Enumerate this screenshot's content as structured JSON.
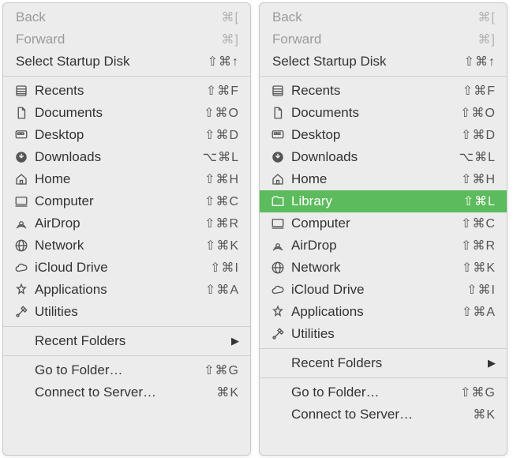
{
  "menus": [
    {
      "groups": [
        [
          {
            "id": "back",
            "label": "Back",
            "shortcut": "⌘[",
            "disabled": true,
            "noicon": true,
            "top": true
          },
          {
            "id": "forward",
            "label": "Forward",
            "shortcut": "⌘]",
            "disabled": true,
            "noicon": true,
            "top": true
          },
          {
            "id": "select-startup-disk",
            "label": "Select Startup Disk",
            "shortcut": "⇧⌘↑",
            "noicon": true,
            "top": true
          }
        ],
        [
          {
            "id": "recents",
            "label": "Recents",
            "shortcut": "⇧⌘F",
            "icon": "recents"
          },
          {
            "id": "documents",
            "label": "Documents",
            "shortcut": "⇧⌘O",
            "icon": "documents"
          },
          {
            "id": "desktop",
            "label": "Desktop",
            "shortcut": "⇧⌘D",
            "icon": "desktop"
          },
          {
            "id": "downloads",
            "label": "Downloads",
            "shortcut": "⌥⌘L",
            "icon": "downloads"
          },
          {
            "id": "home",
            "label": "Home",
            "shortcut": "⇧⌘H",
            "icon": "home"
          },
          {
            "id": "computer",
            "label": "Computer",
            "shortcut": "⇧⌘C",
            "icon": "computer"
          },
          {
            "id": "airdrop",
            "label": "AirDrop",
            "shortcut": "⇧⌘R",
            "icon": "airdrop"
          },
          {
            "id": "network",
            "label": "Network",
            "shortcut": "⇧⌘K",
            "icon": "network"
          },
          {
            "id": "icloud-drive",
            "label": "iCloud Drive",
            "shortcut": "⇧⌘I",
            "icon": "icloud"
          },
          {
            "id": "applications",
            "label": "Applications",
            "shortcut": "⇧⌘A",
            "icon": "applications"
          },
          {
            "id": "utilities",
            "label": "Utilities",
            "shortcut": "",
            "icon": "utilities"
          }
        ],
        [
          {
            "id": "recent-folders",
            "label": "Recent Folders",
            "submenu": true,
            "noicon": true
          }
        ],
        [
          {
            "id": "go-to-folder",
            "label": "Go to Folder…",
            "shortcut": "⇧⌘G",
            "noicon": true
          },
          {
            "id": "connect-to-server",
            "label": "Connect to Server…",
            "shortcut": "⌘K",
            "noicon": true
          }
        ]
      ]
    },
    {
      "groups": [
        [
          {
            "id": "back",
            "label": "Back",
            "shortcut": "⌘[",
            "disabled": true,
            "noicon": true,
            "top": true
          },
          {
            "id": "forward",
            "label": "Forward",
            "shortcut": "⌘]",
            "disabled": true,
            "noicon": true,
            "top": true
          },
          {
            "id": "select-startup-disk",
            "label": "Select Startup Disk",
            "shortcut": "⇧⌘↑",
            "noicon": true,
            "top": true
          }
        ],
        [
          {
            "id": "recents",
            "label": "Recents",
            "shortcut": "⇧⌘F",
            "icon": "recents"
          },
          {
            "id": "documents",
            "label": "Documents",
            "shortcut": "⇧⌘O",
            "icon": "documents"
          },
          {
            "id": "desktop",
            "label": "Desktop",
            "shortcut": "⇧⌘D",
            "icon": "desktop"
          },
          {
            "id": "downloads",
            "label": "Downloads",
            "shortcut": "⌥⌘L",
            "icon": "downloads"
          },
          {
            "id": "home",
            "label": "Home",
            "shortcut": "⇧⌘H",
            "icon": "home"
          },
          {
            "id": "library",
            "label": "Library",
            "shortcut": "⇧⌘L",
            "icon": "library",
            "selected": true
          },
          {
            "id": "computer",
            "label": "Computer",
            "shortcut": "⇧⌘C",
            "icon": "computer"
          },
          {
            "id": "airdrop",
            "label": "AirDrop",
            "shortcut": "⇧⌘R",
            "icon": "airdrop"
          },
          {
            "id": "network",
            "label": "Network",
            "shortcut": "⇧⌘K",
            "icon": "network"
          },
          {
            "id": "icloud-drive",
            "label": "iCloud Drive",
            "shortcut": "⇧⌘I",
            "icon": "icloud"
          },
          {
            "id": "applications",
            "label": "Applications",
            "shortcut": "⇧⌘A",
            "icon": "applications"
          },
          {
            "id": "utilities",
            "label": "Utilities",
            "shortcut": "",
            "icon": "utilities"
          }
        ],
        [
          {
            "id": "recent-folders",
            "label": "Recent Folders",
            "submenu": true,
            "noicon": true
          }
        ],
        [
          {
            "id": "go-to-folder",
            "label": "Go to Folder…",
            "shortcut": "⇧⌘G",
            "noicon": true
          },
          {
            "id": "connect-to-server",
            "label": "Connect to Server…",
            "shortcut": "⌘K",
            "noicon": true
          }
        ]
      ]
    }
  ]
}
